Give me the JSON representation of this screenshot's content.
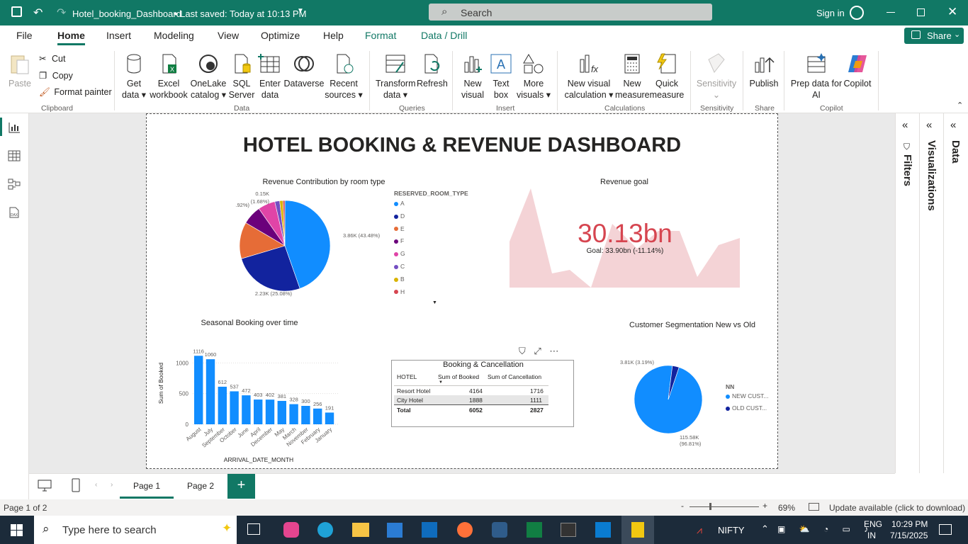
{
  "titlebar": {
    "file_name": "Hotel_booking_Dashboard",
    "saved": "• Last saved: Today at 10:13 PM",
    "search": "Search",
    "sign_in": "Sign in"
  },
  "menu": [
    "File",
    "Home",
    "Insert",
    "Modeling",
    "View",
    "Optimize",
    "Help",
    "Format",
    "Data / Drill"
  ],
  "share": "Share",
  "ribbon": {
    "clipboard": {
      "paste": "Paste",
      "cut": "Cut",
      "copy": "Copy",
      "format_painter": "Format painter",
      "group": "Clipboard"
    },
    "data": {
      "get_data": [
        "Get",
        "data ▾"
      ],
      "excel": [
        "Excel",
        "workbook"
      ],
      "onelake": [
        "OneLake",
        "catalog ▾"
      ],
      "sql": [
        "SQL",
        "Server"
      ],
      "enter": [
        "Enter",
        "data"
      ],
      "dataverse": "Dataverse",
      "recent": [
        "Recent",
        "sources ▾"
      ],
      "group": "Data"
    },
    "queries": {
      "transform": [
        "Transform",
        "data ▾"
      ],
      "refresh": "Refresh",
      "group": "Queries"
    },
    "insert": {
      "new_visual": [
        "New",
        "visual"
      ],
      "text_box": [
        "Text",
        "box"
      ],
      "more": [
        "More",
        "visuals ▾"
      ],
      "group": "Insert"
    },
    "calc": {
      "new_calc": [
        "New visual",
        "calculation ▾"
      ],
      "new_measure": [
        "New",
        "measure"
      ],
      "quick": [
        "Quick",
        "measure"
      ],
      "group": "Calculations"
    },
    "sens": {
      "label": "Sensitivity",
      "group": "Sensitivity"
    },
    "share": {
      "publish": "Publish",
      "group": "Share"
    },
    "copilot": {
      "prep": [
        "Prep data for",
        "AI"
      ],
      "copilot": "Copilot",
      "group": "Copilot"
    }
  },
  "dashboard": {
    "title": "HOTEL BOOKING & REVENUE DASHBOARD",
    "pie": {
      "title": "Revenue Contribution by room type",
      "legend_title": "RESERVED_ROOM_TYPE",
      "labels": [
        "3.86K (43.48%)",
        "2.23K (25.08%)",
        "1.13K (12.73%)",
        "0.59K (6.69%)",
        "0.53K (5.92%)",
        "0.15K",
        "(1.68%)"
      ]
    },
    "kpi": {
      "title": "Revenue goal",
      "value": "30.13bn",
      "goal": "Goal: 33.90bn (-11.14%)"
    },
    "bar": {
      "title": "Seasonal Booking over time",
      "ylabel": "Sum of Booked",
      "xlabel": "ARRIVAL_DATE_MONTH"
    },
    "table": {
      "title": "Booking & Cancellation",
      "headers": [
        "HOTEL",
        "Sum of Booked",
        "Sum of Cancellation"
      ],
      "rows": [
        [
          "Resort Hotel",
          "4164",
          "1716"
        ],
        [
          "City Hotel",
          "1888",
          "1111"
        ],
        [
          "Total",
          "6052",
          "2827"
        ]
      ]
    },
    "seg": {
      "title": "Customer Segmentation New vs Old",
      "legend_title": "NN",
      "items": [
        "NEW CUST...",
        "OLD CUST..."
      ],
      "labels": [
        "3.81K (3.19%)",
        "115.58K",
        "(96.81%)"
      ]
    }
  },
  "chart_data": [
    {
      "type": "pie",
      "title": "Revenue Contribution by room type",
      "legend_title": "RESERVED_ROOM_TYPE",
      "categories": [
        "A",
        "D",
        "E",
        "F",
        "G",
        "C",
        "B",
        "H"
      ],
      "values": [
        3.86,
        2.23,
        1.13,
        0.59,
        0.53,
        0.15,
        0.1,
        0.06
      ],
      "colors": [
        "#118dff",
        "#12239e",
        "#e66c37",
        "#6b007b",
        "#e044a7",
        "#744ec2",
        "#d9b300",
        "#d64550"
      ]
    },
    {
      "type": "bar",
      "title": "Seasonal Booking over time",
      "xlabel": "ARRIVAL_DATE_MONTH",
      "ylabel": "Sum of Booked",
      "categories": [
        "August",
        "July",
        "September",
        "October",
        "June",
        "April",
        "December",
        "May",
        "March",
        "November",
        "February",
        "January"
      ],
      "values": [
        1116,
        1060,
        612,
        537,
        472,
        403,
        402,
        381,
        328,
        300,
        256,
        191
      ],
      "yticks": [
        0,
        500,
        1000
      ],
      "ylim": [
        0,
        1200
      ]
    },
    {
      "type": "pie",
      "title": "Customer Segmentation New vs Old",
      "legend_title": "NN",
      "categories": [
        "NEW CUST...",
        "OLD CUST..."
      ],
      "values": [
        115.58,
        3.81
      ],
      "colors": [
        "#118dff",
        "#12239e"
      ]
    }
  ],
  "page_tabs": [
    "Page 1",
    "Page 2"
  ],
  "status": {
    "page": "Page 1 of 2",
    "zoom": "69%",
    "update": "Update available (click to download)"
  },
  "taskbar": {
    "search": "Type here to search",
    "nifty": "NIFTY",
    "lang": [
      "ENG",
      "IN"
    ],
    "time": "10:29 PM",
    "date": "7/15/2025"
  }
}
